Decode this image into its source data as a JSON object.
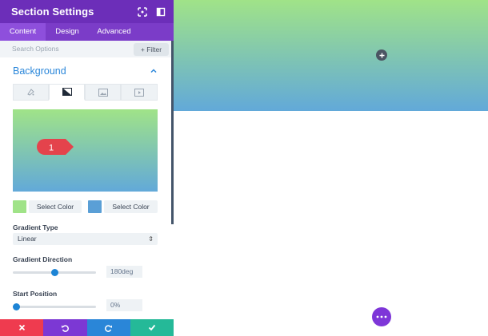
{
  "header": {
    "title": "Section Settings"
  },
  "tabs": [
    {
      "label": "Content",
      "active": true
    },
    {
      "label": "Design",
      "active": false
    },
    {
      "label": "Advanced",
      "active": false
    }
  ],
  "search": {
    "placeholder": "Search Options",
    "filter_label": "+ Filter"
  },
  "section": {
    "title": "Background"
  },
  "background_types": [
    "color-icon",
    "gradient-icon",
    "image-icon",
    "video-icon"
  ],
  "preview": {
    "marker": "1",
    "colors": {
      "start": "#a0e388",
      "end": "#62a9d9"
    }
  },
  "color_stops": {
    "start": {
      "label": "Select Color",
      "color": "#a0e388"
    },
    "end": {
      "label": "Select Color",
      "color": "#5a9fd6"
    }
  },
  "gradient_type": {
    "label": "Gradient Type",
    "value": "Linear"
  },
  "gradient_direction": {
    "label": "Gradient Direction",
    "value": "180deg",
    "fraction": 0.5
  },
  "start_position": {
    "label": "Start Position",
    "value": "0%",
    "fraction": 0.0
  },
  "footer": {
    "buttons": [
      {
        "name": "close",
        "color": "#ef3b4f"
      },
      {
        "name": "undo",
        "color": "#7c38d4"
      },
      {
        "name": "redo",
        "color": "#2a86d8"
      },
      {
        "name": "save",
        "color": "#25b998"
      }
    ]
  },
  "colors": {
    "brand": "#6c2eb9",
    "accent": "#2b87da"
  }
}
